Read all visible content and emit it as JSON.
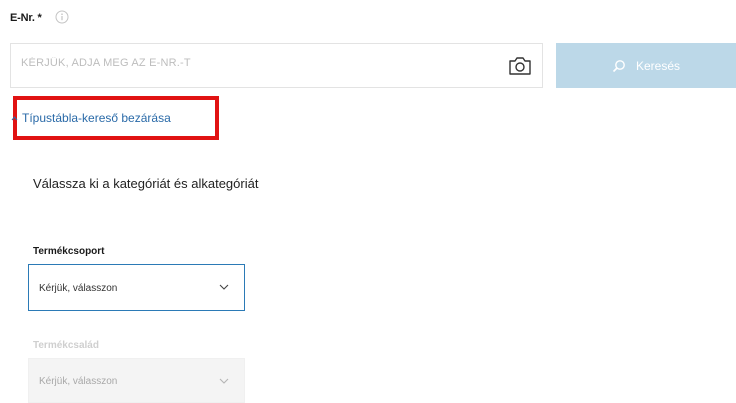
{
  "enr": {
    "label": "E-Nr. *",
    "placeholder": "KÉRJÜK, ADJA MEG AZ E-NR.-T",
    "search_button_label": "Keresés"
  },
  "close_finder_link": "Típustábla-kereső bezárása",
  "section_title": "Válassza ki a kategóriát és alkategóriát",
  "product_group": {
    "label": "Termékcsoport",
    "selected": "Kérjük, válasszon"
  },
  "product_family": {
    "label": "Termékcsalád",
    "selected": "Kérjük, válasszon"
  },
  "colors": {
    "accent": "#2b7ab6",
    "button_disabled": "#bcd8e8",
    "highlight": "#e11212",
    "link": "#2a6aa8"
  }
}
